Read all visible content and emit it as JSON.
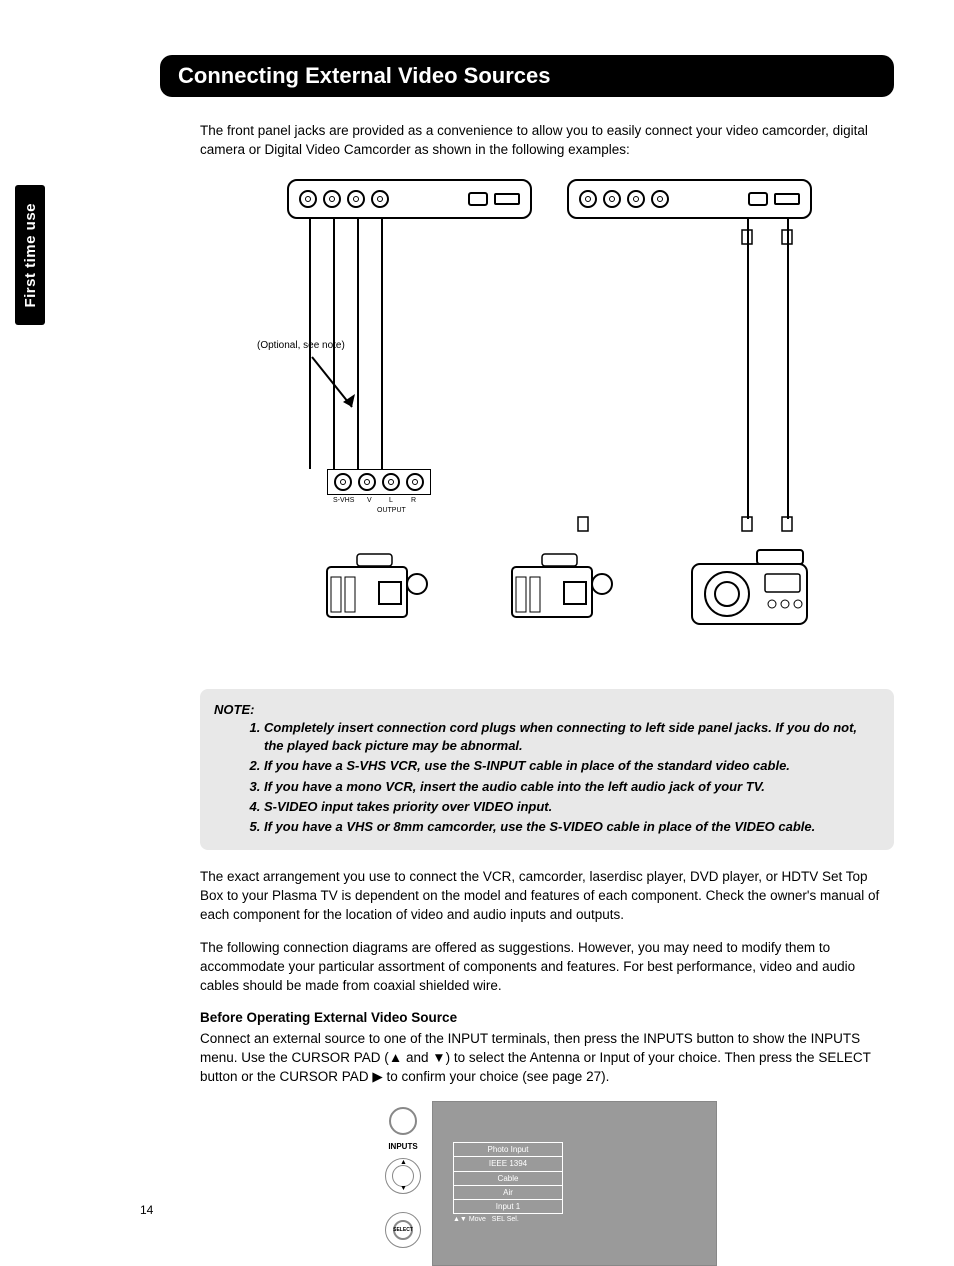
{
  "side_tab": "First time use",
  "header": "Connecting External Video Sources",
  "intro": "The front panel jacks are provided as a convenience to allow you to easily connect your video camcorder, digital camera or Digital Video Camcorder as shown in the following examples:",
  "diagram": {
    "optional_note": "(Optional, see note)",
    "svhs": "S-VHS",
    "v": "V",
    "l": "L",
    "r": "R",
    "output": "OUTPUT"
  },
  "note": {
    "label": "NOTE:",
    "items": [
      "Completely insert connection cord plugs when connecting to left side panel jacks. If you do not, the played back picture may be abnormal.",
      "If you have a S-VHS VCR, use the S-INPUT cable in place of the standard video cable.",
      "If you have a mono VCR, insert the audio cable into the left audio jack of your TV.",
      "S-VIDEO input takes priority over VIDEO input.",
      "If you have a VHS or 8mm camcorder, use the S-VIDEO cable in place of the VIDEO cable."
    ]
  },
  "para2": "The exact arrangement you use to connect the VCR, camcorder, laserdisc player, DVD player, or HDTV Set Top Box to your Plasma TV is dependent on the model and features of each component.  Check the owner's manual of each component for the location of video and audio inputs and outputs.",
  "para3": "The following connection diagrams are offered as suggestions.  However, you may need to modify them to accommodate your particular assortment of components and features.  For best performance, video and audio cables should be made from coaxial shielded wire.",
  "subhead": "Before Operating External Video Source",
  "para4a": "Connect an external source to one of the INPUT terminals, then press the INPUTS button to show the INPUTS menu.  Use the CURSOR PAD (",
  "triangle_up": "▲",
  "para4b": " and ",
  "triangle_down": "▼",
  "para4c": ") to select the Antenna or Input of your choice.  Then press the SELECT button or the CURSOR PAD ",
  "triangle_right": "▶",
  "para4d": " to confirm your choice (see page 27).",
  "remote": {
    "inputs": "INPUTS",
    "select": "SELECT"
  },
  "menu": {
    "items": [
      "Photo Input",
      "IEEE 1394",
      "Cable",
      "Air",
      "Input 1"
    ],
    "footer_move": "Move",
    "footer_sel": "SEL Sel.",
    "footer_arrow": "▲▼"
  },
  "page_number": "14"
}
